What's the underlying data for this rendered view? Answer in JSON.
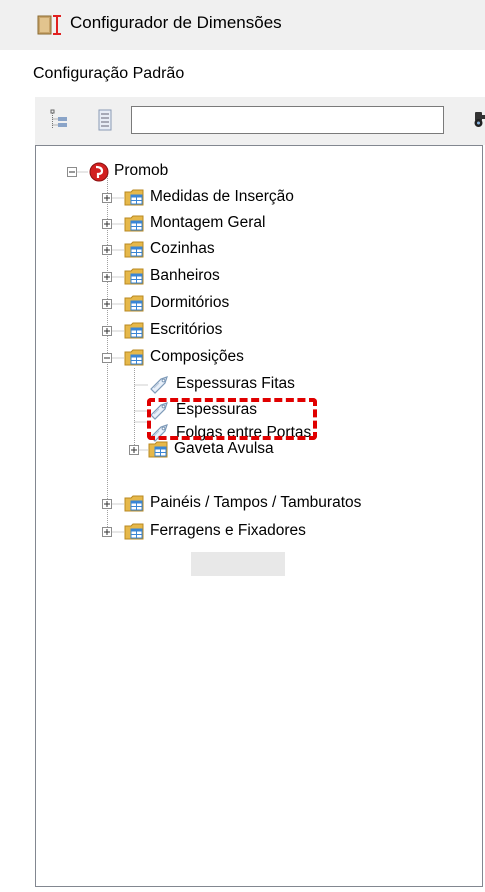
{
  "window": {
    "title": "Configurador de Dimensões",
    "subtitle": "Configuração Padrão"
  },
  "toolbar": {
    "search_value": "",
    "collapse_icon": "collapse-all-icon",
    "expand_icon": "expand-all-icon",
    "find_icon": "binoculars-icon"
  },
  "tree": {
    "root": "Promob",
    "items": [
      {
        "label": "Medidas de Inserção"
      },
      {
        "label": "Montagem Geral"
      },
      {
        "label": "Cozinhas"
      },
      {
        "label": "Banheiros"
      },
      {
        "label": "Dormitórios"
      },
      {
        "label": "Escritórios"
      },
      {
        "label": "Composições"
      },
      {
        "label": "Espessuras Fitas"
      },
      {
        "label": "Espessuras"
      },
      {
        "label": "Folgas entre Portas"
      },
      {
        "label": "Gaveta Avulsa"
      },
      {
        "label": "Painéis / Tampos / Tamburatos"
      },
      {
        "label": "Ferragens e Fixadores"
      }
    ]
  },
  "colors": {
    "folder": "#e6b84a",
    "table_blue": "#3a86d6",
    "root_red": "#d22020",
    "highlight": "#e00000"
  }
}
